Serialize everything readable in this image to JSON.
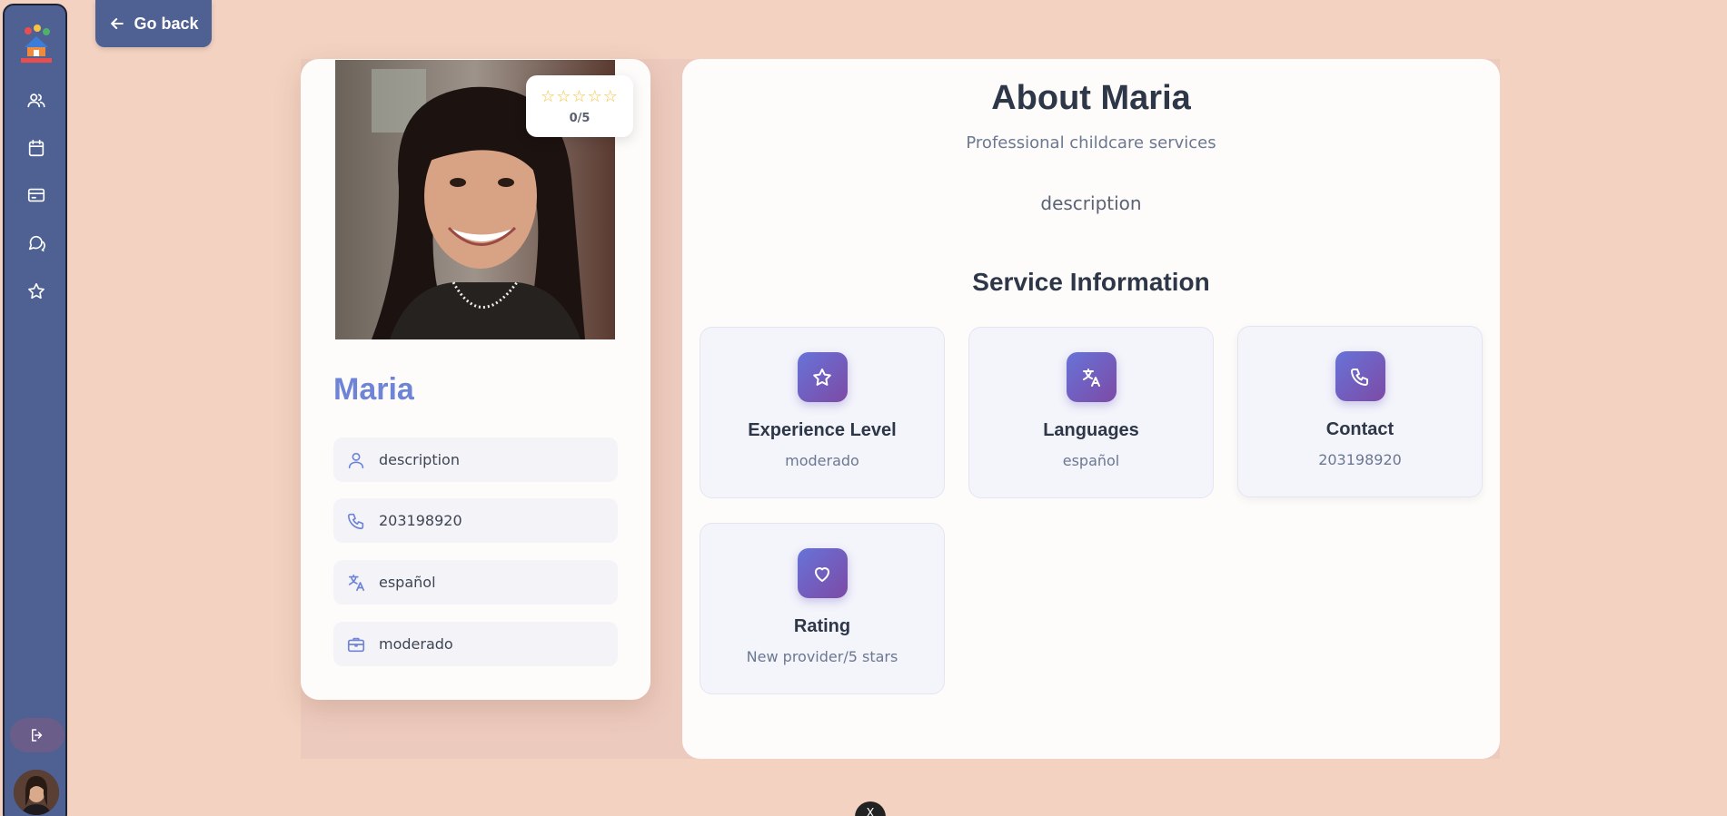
{
  "go_back": {
    "label": "Go back"
  },
  "sidebar": {
    "items": [
      {
        "name": "users"
      },
      {
        "name": "calendar"
      },
      {
        "name": "payments"
      },
      {
        "name": "messages"
      },
      {
        "name": "favorites"
      }
    ]
  },
  "profile": {
    "name": "Maria",
    "rating_stars": "☆☆☆☆☆",
    "rating_text": "0/5",
    "rows": [
      {
        "icon": "user-icon",
        "value": "description"
      },
      {
        "icon": "phone-icon",
        "value": "203198920"
      },
      {
        "icon": "language-icon",
        "value": "español"
      },
      {
        "icon": "briefcase-icon",
        "value": "moderado"
      }
    ]
  },
  "about": {
    "title": "About Maria",
    "subtitle": "Professional childcare services",
    "description": "description",
    "section_title": "Service Information",
    "cards": [
      {
        "label": "Experience Level",
        "value": "moderado",
        "icon": "star-icon"
      },
      {
        "label": "Languages",
        "value": "español",
        "icon": "language-icon"
      },
      {
        "label": "Contact",
        "value": "203198920",
        "icon": "phone-icon"
      },
      {
        "label": "Rating",
        "value": "New provider/5 stars",
        "icon": "heart-icon"
      }
    ]
  },
  "colors": {
    "background": "#f3d2c1",
    "sidebar": "#4e6192",
    "accent": "#6f84d6",
    "icon_gradient_start": "#6773d8",
    "icon_gradient_end": "#7d4aa6",
    "star": "#f6c343"
  },
  "bottom_badge": {
    "label": "X"
  }
}
